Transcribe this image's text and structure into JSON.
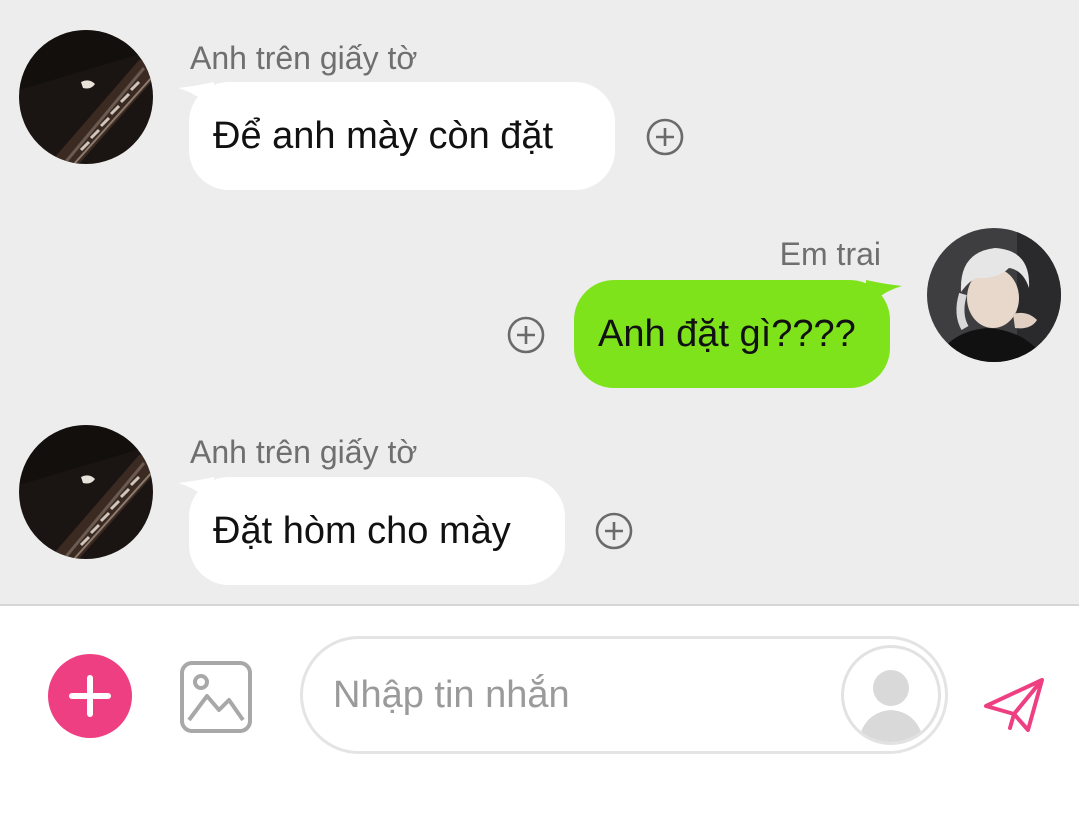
{
  "messages": [
    {
      "direction": "incoming",
      "sender": "Anh trên giấy tờ",
      "text": "Để anh mày còn đặt",
      "avatar_icon": "dark-staircase-avatar-icon",
      "react_icon": "add-reaction-icon"
    },
    {
      "direction": "outgoing",
      "sender": "Em trai",
      "text": "Anh đặt gì????",
      "avatar_icon": "white-hair-person-avatar-icon",
      "react_icon": "add-reaction-icon"
    },
    {
      "direction": "incoming",
      "sender": "Anh trên giấy tờ",
      "text": "Đặt hòm cho mày",
      "avatar_icon": "dark-staircase-avatar-icon",
      "react_icon": "add-reaction-icon"
    }
  ],
  "composer": {
    "placeholder": "Nhập tin nhắn",
    "value": "",
    "add_icon": "plus-icon",
    "image_icon": "image-icon",
    "voice_avatar_icon": "person-silhouette-icon",
    "send_icon": "paper-plane-icon"
  },
  "colors": {
    "chat_background": "#ededed",
    "incoming_bubble": "#ffffff",
    "outgoing_bubble": "#7fe31c",
    "accent_pink": "#ef3f83",
    "sender_name": "#6f6f6f"
  }
}
